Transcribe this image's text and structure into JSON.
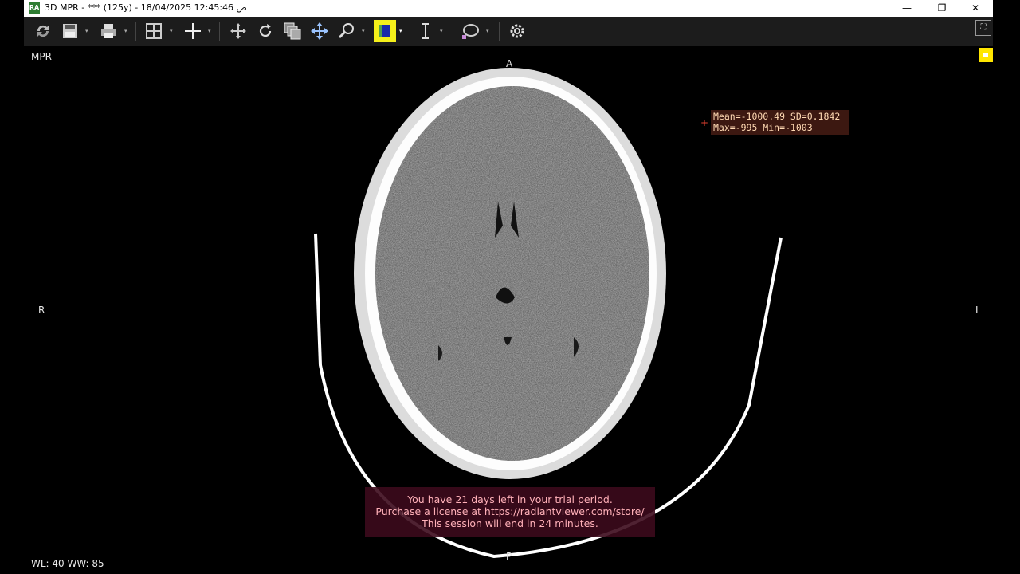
{
  "window": {
    "app_icon": "RA",
    "title": "3D MPR - *** (125y) - 18/04/2025 12:45:46 ص",
    "min_glyph": "—",
    "max_glyph": "❐",
    "close_glyph": "✕"
  },
  "toolbar": {
    "icons": [
      "refresh-icon",
      "save-icon",
      "print-icon",
      "layout-icon",
      "crosshair-icon",
      "pan-icon",
      "rotate-icon",
      "stack-icon",
      "move-icon",
      "zoom-icon",
      "window-level-icon",
      "measure-icon",
      "roi-icon",
      "settings-icon"
    ],
    "dropdown_glyph": "▾",
    "fullscreen_glyph": "⛶"
  },
  "viewport": {
    "view_label": "MPR",
    "orient_top": "A",
    "orient_bottom": "P",
    "orient_left": "R",
    "orient_right": "L",
    "window_level": "WL: 40 WW: 85"
  },
  "roi": {
    "line1": "Mean=-1000.49 SD=0.1842",
    "line2": "Max=-995 Min=-1003",
    "marker": "+"
  },
  "trial_notice": {
    "line1": "You have 21 days left in your trial period.",
    "line2": "Purchase a license at https://radiantviewer.com/store/",
    "line3": "This session will end in 24 minutes."
  },
  "colors": {
    "accent_highlight": "#ffe600",
    "roi_text": "#ffd9b3",
    "trial_text": "#ffb0b8"
  }
}
